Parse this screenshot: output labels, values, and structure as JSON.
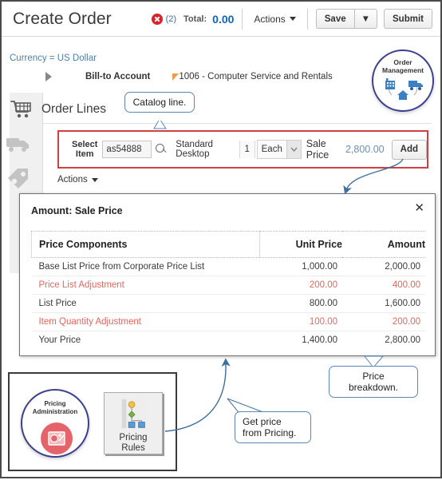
{
  "header": {
    "title": "Create Order",
    "error_icon": "error-circle-icon",
    "error_count": "(2)",
    "total_label": "Total:",
    "total_value": "0.00",
    "actions_label": "Actions",
    "save_label": "Save",
    "save_dropdown_caret": "▼",
    "submit_label": "Submit"
  },
  "subheader": {
    "currency": "Currency = US Dollar",
    "billto_label": "Bill-to Account",
    "billto_value": "1006 - Computer Service and Rentals",
    "expand_icon": "expand-triangle-icon",
    "required_flag_icon": "required-flag-icon"
  },
  "om_badge": {
    "line1": "Order",
    "line2": "Management",
    "icons": [
      "factory-icon",
      "truck-icon",
      "home-icon"
    ]
  },
  "order_lines": {
    "title": "Order Lines",
    "sidebar_icons": [
      "cart-icon",
      "truck-icon",
      "price-tag-icon"
    ],
    "line": {
      "select_item_label_l1": "Select",
      "select_item_label_l2": "Item",
      "item_value": "as54888",
      "item_placeholder": "",
      "search_icon": "magnifier-icon",
      "description": "Standard Desktop",
      "quantity": "1",
      "uom": "Each",
      "uom_caret": "⌄",
      "sale_price_label": "Sale Price",
      "sale_price_value": "2,800.00",
      "add_label": "Add"
    },
    "actions_label": "Actions"
  },
  "dialog": {
    "title": "Amount: Sale Price",
    "close_icon": "close-icon",
    "columns": [
      "Price Components",
      "Unit Price",
      "Amount"
    ],
    "rows": [
      {
        "component": "Base List Price from Corporate  Price List",
        "unit_price": "1,000.00",
        "amount": "2,000.00",
        "adjustment": false
      },
      {
        "component": "Price List Adjustment",
        "unit_price": "200.00",
        "amount": "400.00",
        "adjustment": true
      },
      {
        "component": "List Price",
        "unit_price": "800.00",
        "amount": "1,600.00",
        "adjustment": false
      },
      {
        "component": "Item Quantity Adjustment",
        "unit_price": "100.00",
        "amount": "200.00",
        "adjustment": true
      },
      {
        "component": "Your Price",
        "unit_price": "1,400.00",
        "amount": "2,800.00",
        "adjustment": false
      }
    ]
  },
  "bottom_box": {
    "pricing_admin_l1": "Pricing",
    "pricing_admin_l2": "Administration",
    "pricing_admin_icon": "pricing-admin-icon",
    "pricing_rules_icon": "pricing-rules-icon",
    "pricing_rules_l1": "Pricing",
    "pricing_rules_l2": "Rules"
  },
  "callouts": {
    "catalog_line": "Catalog line.",
    "price_breakdown": "Price breakdown.",
    "get_price": "Get price\nfrom Pricing."
  },
  "colors": {
    "accent_blue": "#0a66c2",
    "error_red": "#d8242a",
    "highlight_border": "#d04040",
    "adjustment_red": "#e8655b",
    "link_blue": "#4a7fb5",
    "callout_border": "#5b86b5"
  }
}
